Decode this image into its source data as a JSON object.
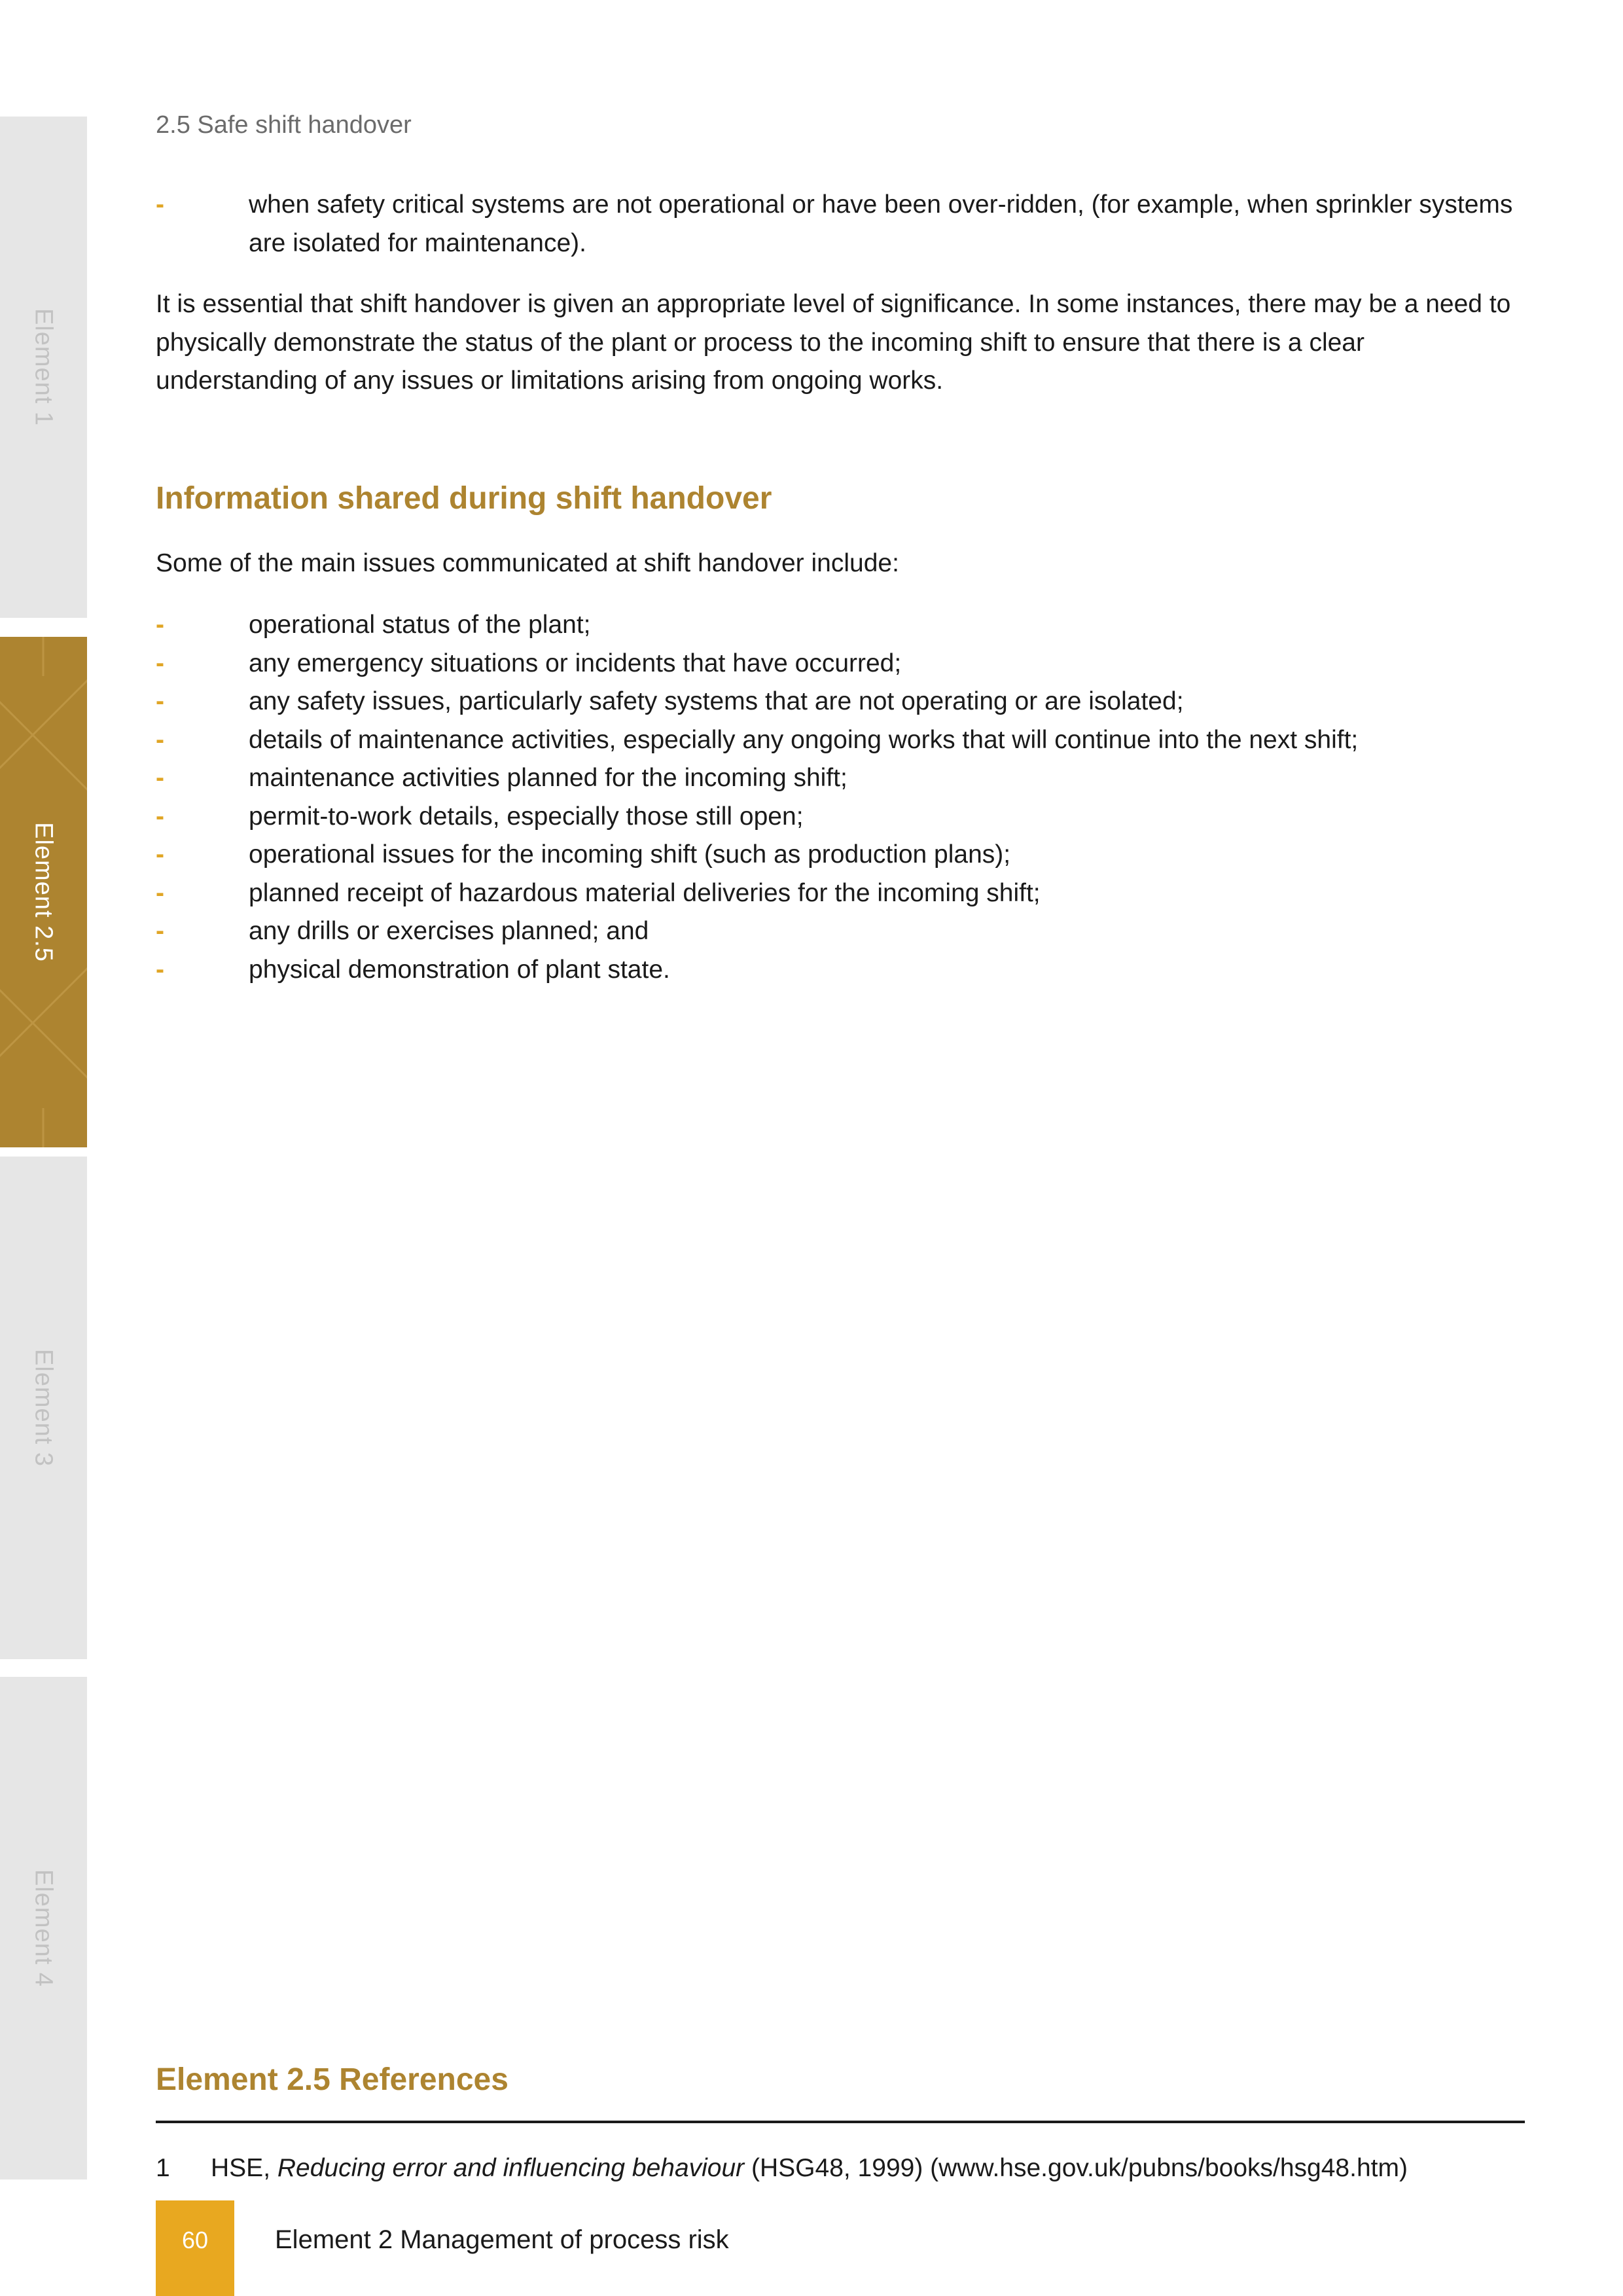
{
  "side_tabs": [
    {
      "label": "Element 1",
      "active": false
    },
    {
      "label": "Element 2.5",
      "active": true
    },
    {
      "label": "Element 3",
      "active": false
    },
    {
      "label": "Element 4",
      "active": false
    }
  ],
  "header": {
    "section": "2.5  Safe shift handover"
  },
  "intro_bullets": [
    "when safety critical systems are not operational or have been over-ridden, (for example, when sprinkler systems are isolated for maintenance)."
  ],
  "bullet_marker": "-",
  "paragraph_1": "It is essential that shift handover is given an appropriate level of significance. In some instances, there may be a need to physically demonstrate the status of the plant or process to the incoming shift to ensure that there is a clear understanding of any issues or limitations arising from ongoing works.",
  "info_section": {
    "heading": "Information shared during shift handover",
    "lead": "Some of the main issues communicated at shift handover include:",
    "items": [
      "operational status of the plant;",
      "any emergency situations or incidents that have occurred;",
      "any safety issues, particularly safety systems that are not operating or are isolated;",
      "details of maintenance activities, especially any ongoing works that will continue into the next shift;",
      "maintenance activities planned for the incoming shift;",
      "permit-to-work details, especially those still open;",
      "operational issues for the incoming shift (such as production plans);",
      "planned receipt of hazardous material deliveries for the incoming shift;",
      "any drills or exercises planned; and",
      "physical demonstration of plant state."
    ]
  },
  "references": {
    "heading": "Element 2.5 References",
    "items": [
      {
        "number": "1",
        "prefix": "HSE, ",
        "title": "Reducing error and influencing behaviour",
        "suffix": " (HSG48, 1999) (www.hse.gov.uk/pubns/books/hsg48.htm)"
      }
    ]
  },
  "footer": {
    "page_number": "60",
    "text": "Element 2 Management of process risk"
  },
  "colors": {
    "accent_gold": "#ad8430",
    "bullet_orange": "#e0a525",
    "page_box": "#e8a820",
    "tab_inactive": "#e6e6e6"
  }
}
